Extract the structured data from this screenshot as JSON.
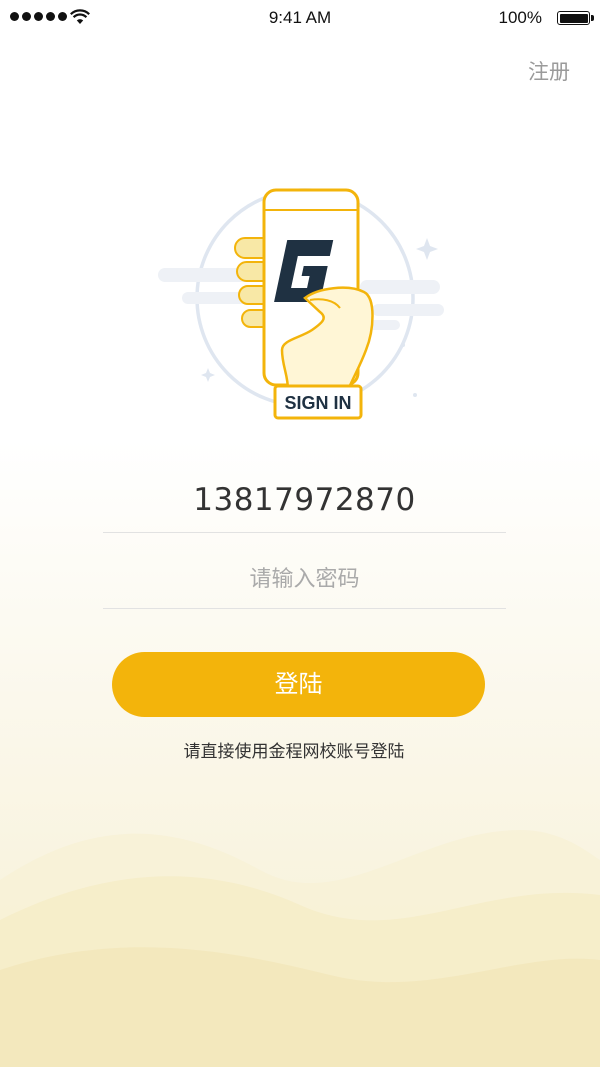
{
  "status_bar": {
    "time": "9:41 AM",
    "battery_percent": "100%",
    "signal_bars": 5
  },
  "header": {
    "register_link": "注册"
  },
  "hero": {
    "badge_text": "SIGN IN",
    "logo_letter": "G",
    "icon": "hand-holding-phone-icon",
    "colors": {
      "accent": "#f3b40b",
      "logo": "#1f3142",
      "circle": "#dfe6f0"
    }
  },
  "form": {
    "phone_value": "13817972870",
    "password_placeholder": "请输入密码"
  },
  "actions": {
    "login_label": "登陆",
    "login_color": "#f3b40b"
  },
  "footer": {
    "hint": "请直接使用金程网校账号登陆"
  }
}
